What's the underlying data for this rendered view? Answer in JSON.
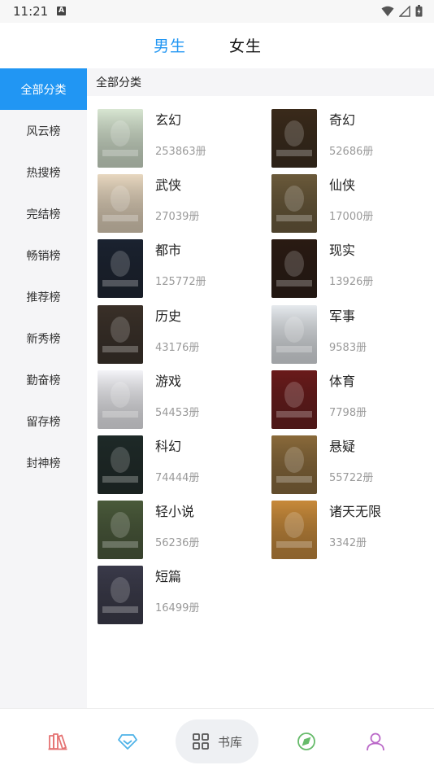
{
  "status_bar": {
    "time": "11:21",
    "notification": "A"
  },
  "gender_tabs": [
    {
      "label": "男生",
      "active": true
    },
    {
      "label": "女生",
      "active": false
    }
  ],
  "sidebar": {
    "items": [
      {
        "label": "全部分类",
        "active": true
      },
      {
        "label": "风云榜"
      },
      {
        "label": "热搜榜"
      },
      {
        "label": "完结榜"
      },
      {
        "label": "畅销榜"
      },
      {
        "label": "推荐榜"
      },
      {
        "label": "新秀榜"
      },
      {
        "label": "勤奋榜"
      },
      {
        "label": "留存榜"
      },
      {
        "label": "封神榜"
      }
    ]
  },
  "main": {
    "section_title": "全部分类",
    "categories": [
      {
        "name": "玄幻",
        "count": "253863册",
        "cover_color": "#d8e6d2"
      },
      {
        "name": "奇幻",
        "count": "52686册",
        "cover_color": "#3a2a1a"
      },
      {
        "name": "武侠",
        "count": "27039册",
        "cover_color": "#e8d8c0"
      },
      {
        "name": "仙侠",
        "count": "17000册",
        "cover_color": "#6b5a3a"
      },
      {
        "name": "都市",
        "count": "125772册",
        "cover_color": "#1a2230"
      },
      {
        "name": "现实",
        "count": "13926册",
        "cover_color": "#2a1a12"
      },
      {
        "name": "历史",
        "count": "43176册",
        "cover_color": "#3a3028"
      },
      {
        "name": "军事",
        "count": "9583册",
        "cover_color": "#e6eaee"
      },
      {
        "name": "游戏",
        "count": "54453册",
        "cover_color": "#f4f4f8"
      },
      {
        "name": "体育",
        "count": "7798册",
        "cover_color": "#6a1a1a"
      },
      {
        "name": "科幻",
        "count": "74444册",
        "cover_color": "#1e2a28"
      },
      {
        "name": "悬疑",
        "count": "55722册",
        "cover_color": "#8a6a3a"
      },
      {
        "name": "轻小说",
        "count": "56236册",
        "cover_color": "#4a5a3a"
      },
      {
        "name": "诸天无限",
        "count": "3342册",
        "cover_color": "#c88a3a"
      },
      {
        "name": "短篇",
        "count": "16499册",
        "cover_color": "#3a3a4a"
      }
    ]
  },
  "bottom_nav": {
    "items": [
      {
        "icon": "books-icon",
        "color": "#e57373"
      },
      {
        "icon": "diamond-icon",
        "color": "#4fb3e8"
      },
      {
        "icon": "grid-icon",
        "label": "书库",
        "active": true,
        "color": "#555555"
      },
      {
        "icon": "compass-icon",
        "color": "#66bb6a"
      },
      {
        "icon": "user-icon",
        "color": "#ba68c8"
      }
    ]
  }
}
